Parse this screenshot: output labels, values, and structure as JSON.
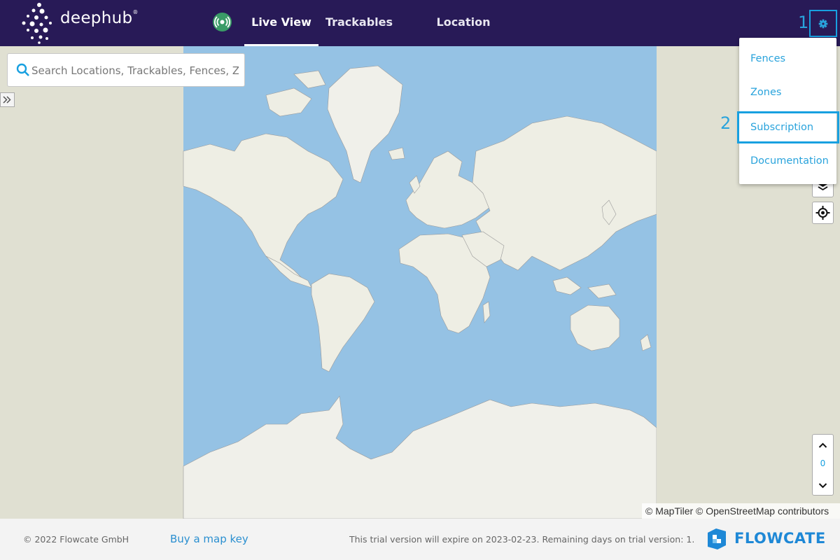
{
  "header": {
    "logo_text": "deephub",
    "logo_reg": "®",
    "tabs": [
      {
        "label": "Live View",
        "active": true
      },
      {
        "label": "Trackables",
        "active": false
      },
      {
        "label": "Location Providers",
        "active": false
      }
    ],
    "status_icon": "broadcast-icon",
    "settings_icon": "gear-icon"
  },
  "annotations": {
    "marker_1": "1",
    "marker_2": "2"
  },
  "search": {
    "placeholder": "Search Locations, Trackables, Fences, Zones"
  },
  "settings_menu": {
    "items": [
      {
        "label": "Fences"
      },
      {
        "label": "Zones"
      },
      {
        "label": "Subscription"
      },
      {
        "label": "Documentation"
      }
    ]
  },
  "map": {
    "floor_value": "0",
    "attribution": "© MapTiler © OpenStreetMap contributors",
    "colors": {
      "ocean": "#95c2e4",
      "land": "#eeeee4",
      "background": "#e0e0d2"
    }
  },
  "footer": {
    "copyright": "© 2022 Flowcate GmbH",
    "map_key_link": "Buy a map key",
    "trial_notice": "This trial version will expire on 2023-02-23. Remaining days on trial version: 1.",
    "brand": "FLOWCATE"
  },
  "colors": {
    "header_bg": "#281a57",
    "accent": "#18a0e0",
    "status_green": "#3a9b67"
  }
}
